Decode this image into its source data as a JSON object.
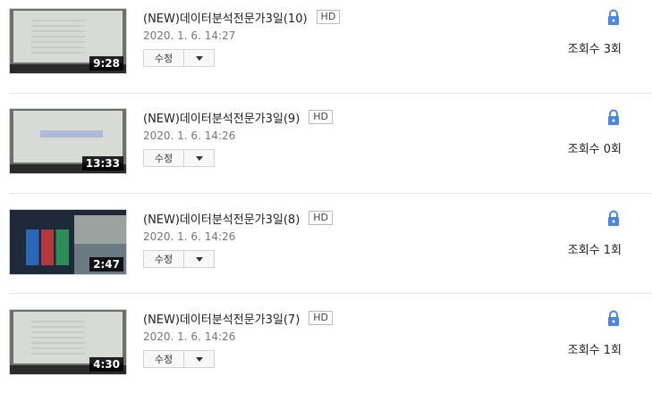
{
  "items": [
    {
      "title": "(NEW)데이터분석전문가3일(10)",
      "badge": "HD",
      "date": "2020. 1. 6. 14:27",
      "edit_label": "수정",
      "duration": "9:28",
      "views": "조회수 3회",
      "thumb_style": "doc"
    },
    {
      "title": "(NEW)데이터분석전문가3일(9)",
      "badge": "HD",
      "date": "2020. 1. 6. 14:26",
      "edit_label": "수정",
      "duration": "13:33",
      "views": "조회수 0회",
      "thumb_style": "blue"
    },
    {
      "title": "(NEW)데이터분석전문가3일(8)",
      "badge": "HD",
      "date": "2020. 1. 6. 14:26",
      "edit_label": "수정",
      "duration": "2:47",
      "views": "조회수 1회",
      "thumb_style": "win"
    },
    {
      "title": "(NEW)데이터분석전문가3일(7)",
      "badge": "HD",
      "date": "2020. 1. 6. 14:26",
      "edit_label": "수정",
      "duration": "4:30",
      "views": "조회수 1회",
      "thumb_style": "doc"
    }
  ],
  "icons": {
    "privacy": "lock-icon",
    "menu": "chevron-down-icon"
  },
  "colors": {
    "lock": "#4a86e8",
    "duration_bg": "#000000",
    "separator": "#e5e5e5"
  }
}
